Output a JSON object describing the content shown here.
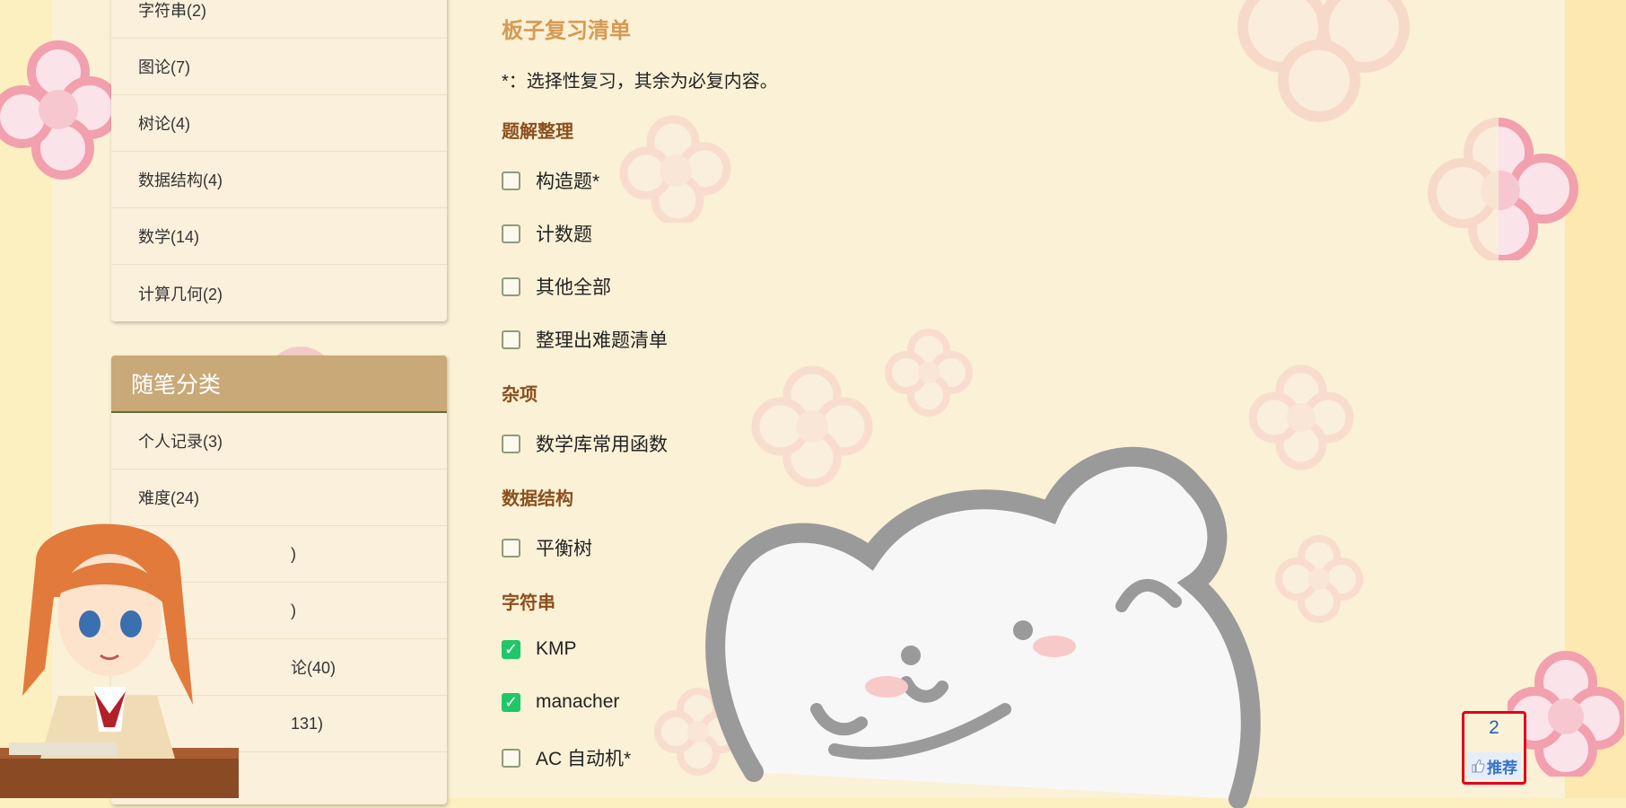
{
  "sidebar": {
    "list1": [
      {
        "label": "字符串(2)"
      },
      {
        "label": "图论(7)"
      },
      {
        "label": "树论(4)"
      },
      {
        "label": "数据结构(4)"
      },
      {
        "label": "数学(14)"
      },
      {
        "label": "计算几何(2)"
      }
    ],
    "panel2_title": "随笔分类",
    "list2": [
      {
        "label": "个人记录(3)"
      },
      {
        "label": "难度(24)"
      },
      {
        "label": ")"
      },
      {
        "label": ")"
      },
      {
        "label": "论(40)"
      },
      {
        "label": "131)"
      }
    ]
  },
  "post": {
    "title": "板子复习清单",
    "note": "*：选择性复习，其余为必复内容。",
    "sections": [
      {
        "title": "题解整理",
        "items": [
          {
            "label": "构造题*",
            "checked": false
          },
          {
            "label": "计数题",
            "checked": false
          },
          {
            "label": "其他全部",
            "checked": false
          },
          {
            "label": "整理出难题清单",
            "checked": false
          }
        ]
      },
      {
        "title": "杂项",
        "items": [
          {
            "label": "数学库常用函数",
            "checked": false
          }
        ]
      },
      {
        "title": "数据结构",
        "items": [
          {
            "label": "平衡树",
            "checked": false
          }
        ]
      },
      {
        "title": "字符串",
        "items": [
          {
            "label": "KMP",
            "checked": true
          },
          {
            "label": "manacher",
            "checked": true
          },
          {
            "label": "AC 自动机*",
            "checked": false
          }
        ]
      }
    ]
  },
  "recommend": {
    "count": "2",
    "label": "推荐"
  },
  "check_mark": "✓",
  "colors": {
    "accent": "#d59a53",
    "section": "#8b4f1e",
    "checked": "#1fc76a",
    "recommend_border": "#e0001c"
  },
  "icons": [
    "thumbs-up-icon",
    "checkbox-icon",
    "flower-decoration",
    "anime-girl-mascot",
    "bear-illustration"
  ]
}
